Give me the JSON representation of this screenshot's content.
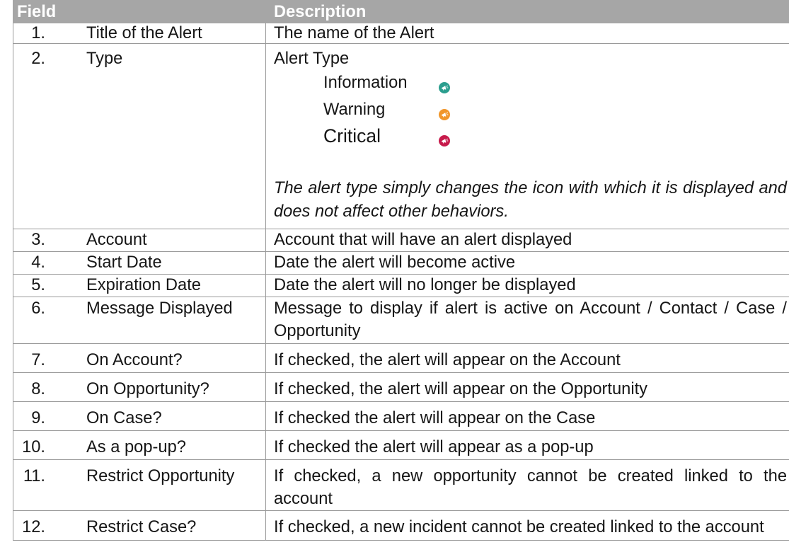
{
  "table": {
    "headers": {
      "field": "Field",
      "description": "Description"
    },
    "rows": [
      {
        "number": "1.",
        "field": "Title of the Alert",
        "description": "The name of the Alert"
      },
      {
        "number": "2.",
        "field": "Type",
        "description": "Alert Type",
        "alert_types": [
          {
            "label": "Information",
            "icon": "megaphone-icon",
            "color": "#2b9e8e"
          },
          {
            "label": "Warning",
            "icon": "megaphone-icon",
            "color": "#f1962a"
          },
          {
            "label": "Critical",
            "icon": "megaphone-icon",
            "color": "#c71a4b"
          }
        ],
        "note": "The alert type simply changes the icon with which it is displayed and does not affect other behaviors."
      },
      {
        "number": "3.",
        "field": "Account",
        "description": "Account that will have an alert displayed"
      },
      {
        "number": "4.",
        "field": "Start Date",
        "description": "Date the alert will become active"
      },
      {
        "number": "5.",
        "field": "Expiration Date",
        "description": "Date the alert will no longer be displayed"
      },
      {
        "number": "6.",
        "field": "Message Displayed",
        "description": "Message to display if alert is active on Account / Contact / Case / Opportunity"
      },
      {
        "number": "7.",
        "field": "On Account?",
        "description": "If checked, the alert will appear on the Account"
      },
      {
        "number": "8.",
        "field": "On Opportunity?",
        "description": "If checked, the alert will appear on the Opportunity"
      },
      {
        "number": "9.",
        "field": "On Case?",
        "description": "If checked the alert will appear on the Case"
      },
      {
        "number": "10.",
        "field": "As a pop-up?",
        "description": "If checked the alert will appear as a pop-up"
      },
      {
        "number": "11.",
        "field": "Restrict Opportunity",
        "description": "If checked, a new opportunity cannot be created linked to the account"
      },
      {
        "number": "12.",
        "field": "Restrict Case?",
        "description": "If checked, a new incident cannot be created linked to the account"
      }
    ]
  }
}
